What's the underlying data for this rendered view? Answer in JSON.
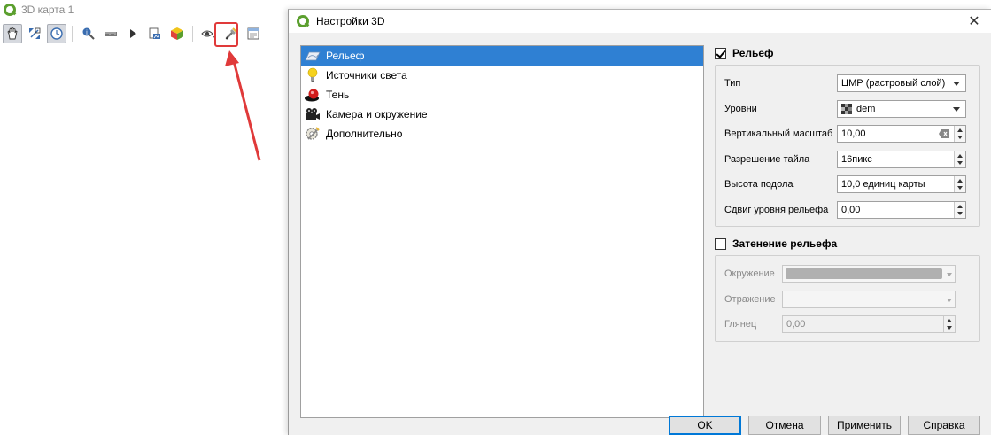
{
  "map_window": {
    "title": "3D карта 1",
    "toolbar_icons": [
      "pan-hand-icon",
      "zoom-full-icon",
      "camera-control-icon",
      "identify-icon",
      "measure-icon",
      "play-icon",
      "export-image-icon",
      "export-3d-icon",
      "view-icon",
      "configure-wrench-icon",
      "layout-icon"
    ]
  },
  "dialog": {
    "title": "Настройки 3D",
    "nav": [
      {
        "label": "Рельеф",
        "icon": "terrain-icon",
        "selected": true
      },
      {
        "label": "Источники света",
        "icon": "light-bulb-icon",
        "selected": false
      },
      {
        "label": "Тень",
        "icon": "shadow-sphere-icon",
        "selected": false
      },
      {
        "label": "Камера и окружение",
        "icon": "camera-icon",
        "selected": false
      },
      {
        "label": "Дополнительно",
        "icon": "advanced-settings-icon",
        "selected": false
      }
    ],
    "terrain": {
      "header": "Рельеф",
      "checked": true,
      "type_label": "Тип",
      "type_value": "ЦМР (растровый слой)",
      "levels_label": "Уровни",
      "levels_value": "dem",
      "vscale_label": "Вертикальный масштаб",
      "vscale_value": "10,00",
      "tile_res_label": "Разрешение тайла",
      "tile_res_value": "16пикс",
      "skirt_label": "Высота подола",
      "skirt_value": "10,0 единиц карты",
      "offset_label": "Сдвиг уровня рельефа",
      "offset_value": "0,00"
    },
    "shading": {
      "header": "Затенение рельефа",
      "checked": false,
      "ambient_label": "Окружение",
      "specular_label": "Отражение",
      "shininess_label": "Глянец",
      "shininess_value": "0,00"
    },
    "buttons": {
      "ok": "OK",
      "cancel": "Отмена",
      "apply": "Применить",
      "help": "Справка"
    }
  }
}
